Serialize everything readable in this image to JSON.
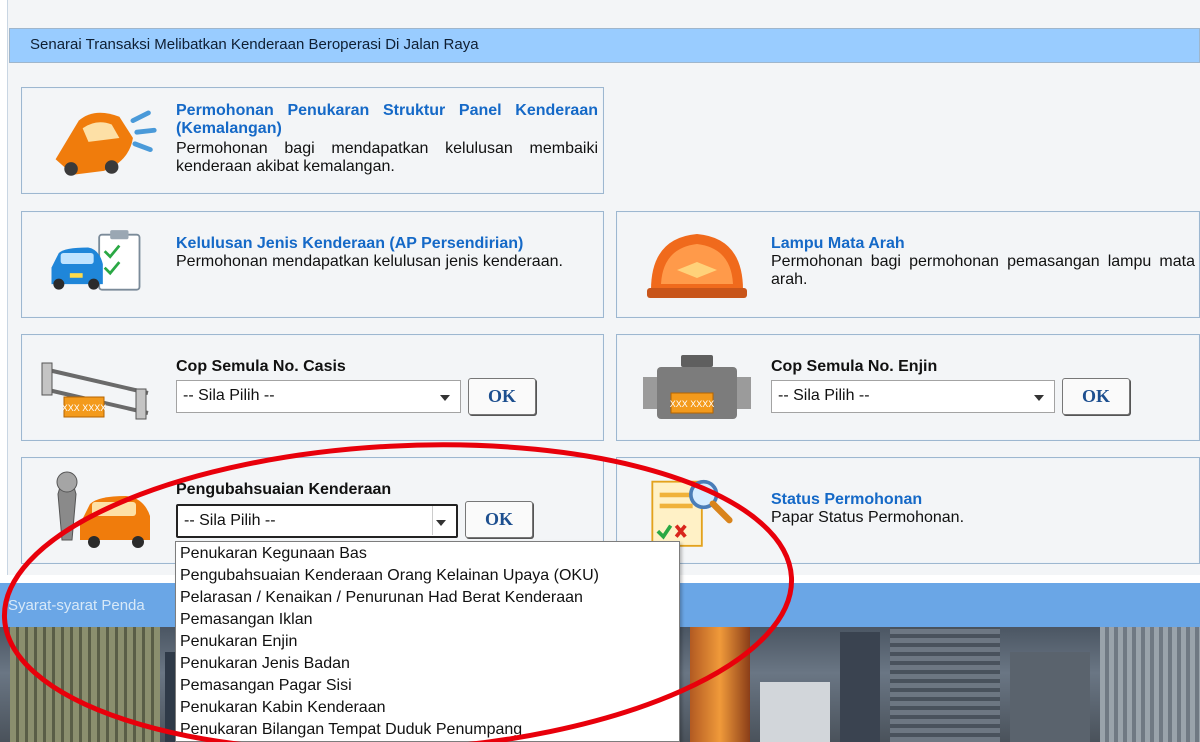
{
  "header": {
    "title": "Senarai Transaksi Melibatkan Kenderaan Beroperasi Di Jalan Raya"
  },
  "panels": {
    "struktur": {
      "title": "Permohonan Penukaran Struktur Panel Kenderaan (Kemalangan)",
      "desc": "Permohonan bagi mendapatkan kelulusan membaiki kenderaan akibat kemalangan.",
      "icon": "crashed-car-icon"
    },
    "ap": {
      "title": "Kelulusan Jenis Kenderaan (AP Persendirian)",
      "desc": "Permohonan mendapatkan kelulusan jenis kenderaan.",
      "icon": "car-checklist-icon"
    },
    "lampu": {
      "title": "Lampu Mata Arah",
      "desc": "Permohonan bagi permohonan pemasangan lampu mata arah.",
      "icon": "beacon-lamp-icon"
    },
    "casis": {
      "title": "Cop Semula No. Casis",
      "select_value": "-- Sila Pilih --",
      "ok_label": "OK",
      "icon": "chassis-icon"
    },
    "enjin": {
      "title": "Cop Semula No. Enjin",
      "select_value": "-- Sila Pilih --",
      "ok_label": "OK",
      "icon": "engine-icon"
    },
    "pengubahsuaian": {
      "title": "Pengubahsuaian Kenderaan",
      "select_value": "-- Sila Pilih --",
      "ok_label": "OK",
      "icon": "car-wrench-icon"
    },
    "status": {
      "title": "Status Permohonan",
      "desc": "Papar Status Permohonan.",
      "icon": "status-document-icon"
    }
  },
  "dropdown": {
    "options": [
      "Penukaran Kegunaan Bas",
      "Pengubahsuaian Kenderaan Orang Kelainan Upaya (OKU)",
      "Pelarasan / Kenaikan / Penurunan Had Berat Kenderaan",
      "Pemasangan Iklan",
      "Penukaran Enjin",
      "Penukaran Jenis Badan",
      "Pemasangan Pagar Sisi",
      "Penukaran Kabin Kenderaan",
      "Penukaran Bilangan Tempat Duduk Penumpang"
    ]
  },
  "footer_bar": {
    "text": "Syarat-syarat Penda"
  },
  "colors": {
    "header_bg": "#99ccff",
    "title_blue": "#1569c7",
    "annotation_red": "#e8000b"
  }
}
